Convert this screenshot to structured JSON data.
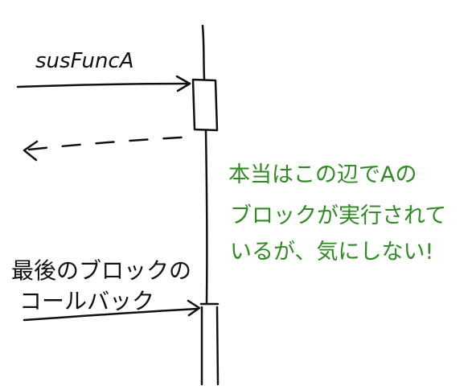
{
  "diagram": {
    "call_label": "susFuncA",
    "callback_label_line1": "最後のブロックの",
    "callback_label_line2": "コールバック",
    "note_line1": "本当はこの辺でAの",
    "note_line2": "ブロックが実行されて",
    "note_line3": "いるが、気にしない!",
    "colors": {
      "ink": "#111111",
      "note": "#2e8b22",
      "background": "#ffffff"
    }
  }
}
